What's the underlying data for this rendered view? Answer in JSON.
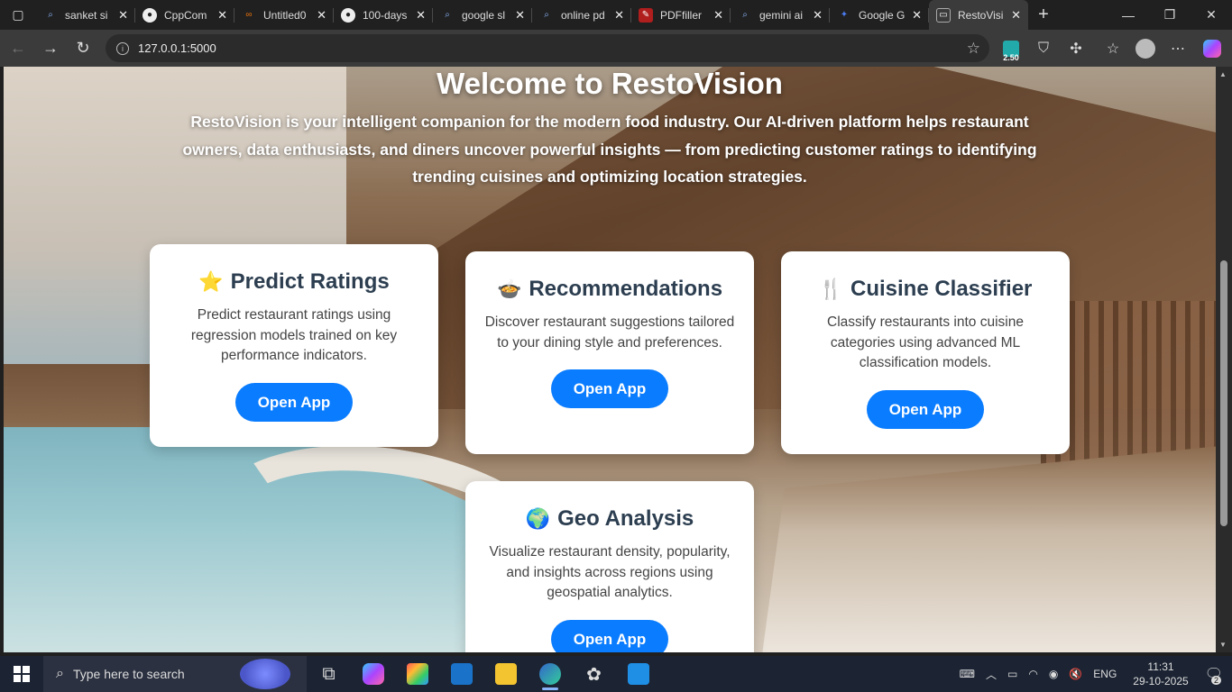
{
  "browser": {
    "tabs": [
      {
        "title": "sanket si",
        "icon": "search-icon",
        "color": "#2b2b2b"
      },
      {
        "title": "CppCom",
        "icon": "github-icon",
        "color": "#2b2b2b"
      },
      {
        "title": "Untitled0",
        "icon": "colab-icon",
        "color": "#e8710a"
      },
      {
        "title": "100-days",
        "icon": "github-icon",
        "color": "#2b2b2b"
      },
      {
        "title": "google sl",
        "icon": "search-icon",
        "color": "#2b2b2b"
      },
      {
        "title": "online pd",
        "icon": "search-icon",
        "color": "#2b2b2b"
      },
      {
        "title": "PDFfiller",
        "icon": "pdffiller-icon",
        "color": "#b01e1e"
      },
      {
        "title": "gemini ai",
        "icon": "search-icon",
        "color": "#2b2b2b"
      },
      {
        "title": "Google G",
        "icon": "gemini-icon",
        "color": "#4a7cf0"
      },
      {
        "title": "RestoVisi",
        "icon": "page-icon",
        "color": "#3b3b3b"
      }
    ],
    "url": "127.0.0.1:5000",
    "edge_badge": "2.50"
  },
  "hero": {
    "title": "Welcome to RestoVision",
    "brand": "RestoVision",
    "text": " is your intelligent companion for the modern food industry. Our AI-driven platform helps restaurant owners, data enthusiasts, and diners uncover powerful insights — from predicting customer ratings to identifying trending cuisines and optimizing location strategies."
  },
  "cards": [
    {
      "emoji": "⭐",
      "title": "Predict Ratings",
      "text": "Predict restaurant ratings using regression models trained on key performance indicators.",
      "button": "Open App"
    },
    {
      "emoji": "🍲",
      "title": "Recommendations",
      "text": "Discover restaurant suggestions tailored to your dining style and preferences.",
      "button": "Open App"
    },
    {
      "emoji": "🍴",
      "title": "Cuisine Classifier",
      "text": "Classify restaurants into cuisine categories using advanced ML classification models.",
      "button": "Open App"
    },
    {
      "emoji": "🌍",
      "title": "Geo Analysis",
      "text": "Visualize restaurant density, popularity, and insights across regions using geospatial analytics.",
      "button": "Open App"
    }
  ],
  "taskbar": {
    "search_placeholder": "Type here to search",
    "language": "ENG",
    "time": "11:31",
    "date": "29-10-2025",
    "notifications": "2"
  }
}
